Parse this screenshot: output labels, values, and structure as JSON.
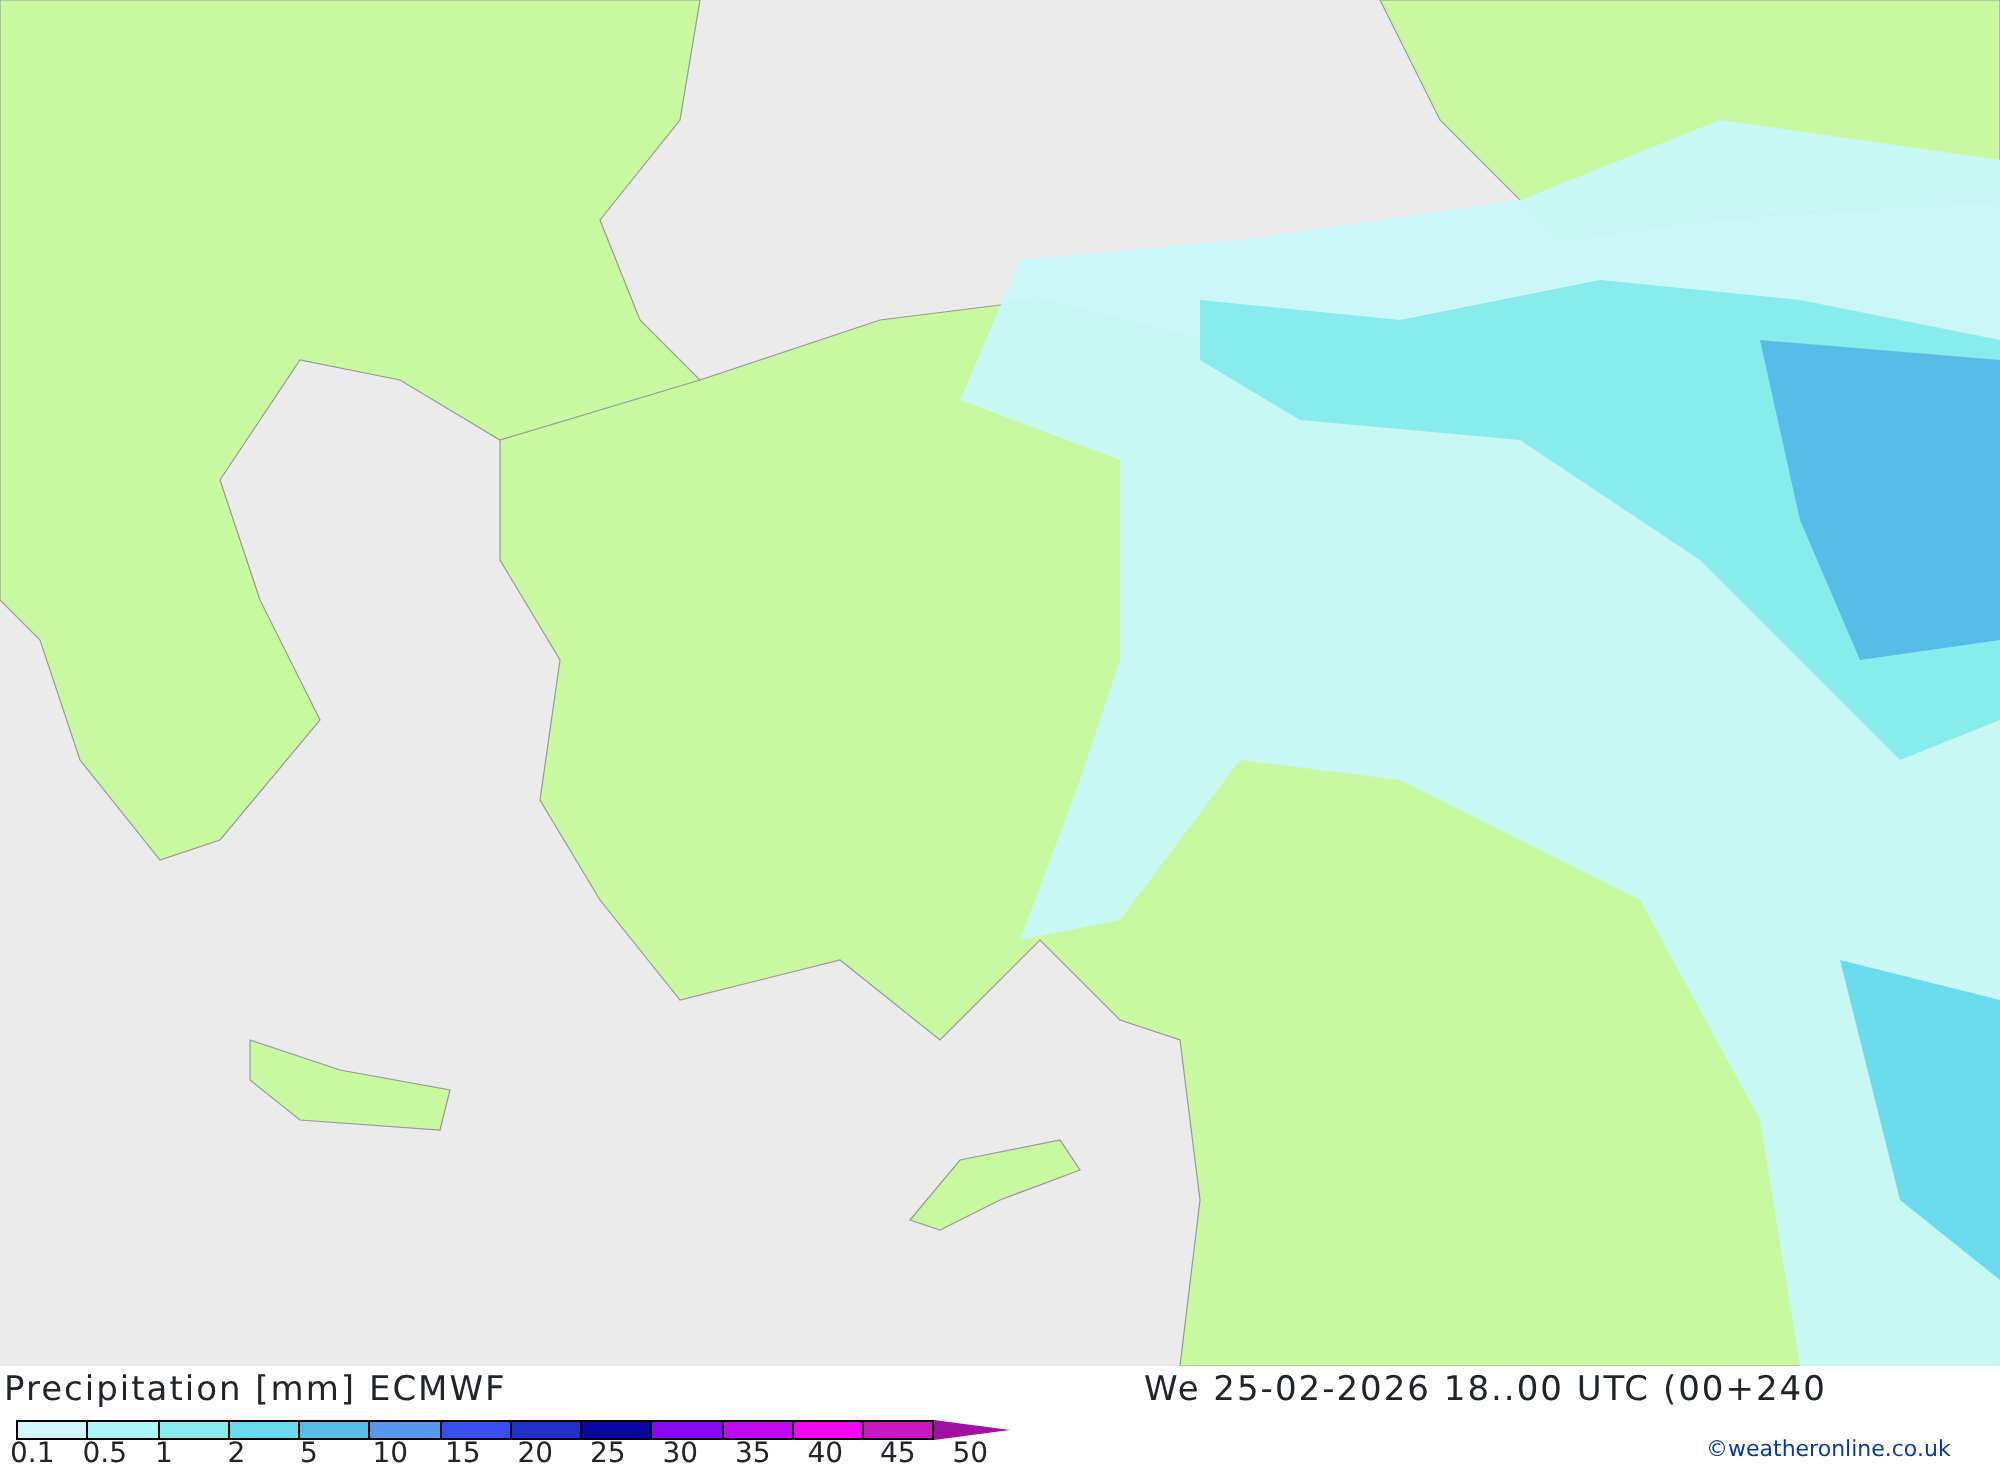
{
  "title": "Precipitation [mm] ECMWF",
  "valid_time": "We 25-02-2026 18..00 UTC (00+240",
  "legend": [
    {
      "label": "0.1",
      "color": "#d0f8f8"
    },
    {
      "label": "0.5",
      "color": "#a8f8f8"
    },
    {
      "label": "1",
      "color": "#88ecec"
    },
    {
      "label": "2",
      "color": "#68dcec"
    },
    {
      "label": "5",
      "color": "#58bce8"
    },
    {
      "label": "10",
      "color": "#5898ec"
    },
    {
      "label": "15",
      "color": "#3850f0"
    },
    {
      "label": "20",
      "color": "#2030c8"
    },
    {
      "label": "25",
      "color": "#0808a0"
    },
    {
      "label": "30",
      "color": "#8808f0"
    },
    {
      "label": "35",
      "color": "#c008f0"
    },
    {
      "label": "40",
      "color": "#f008f0"
    },
    {
      "label": "45",
      "color": "#c818c0"
    }
  ],
  "legend_end_label": "50",
  "credit": "©weatheronline.co.uk"
}
